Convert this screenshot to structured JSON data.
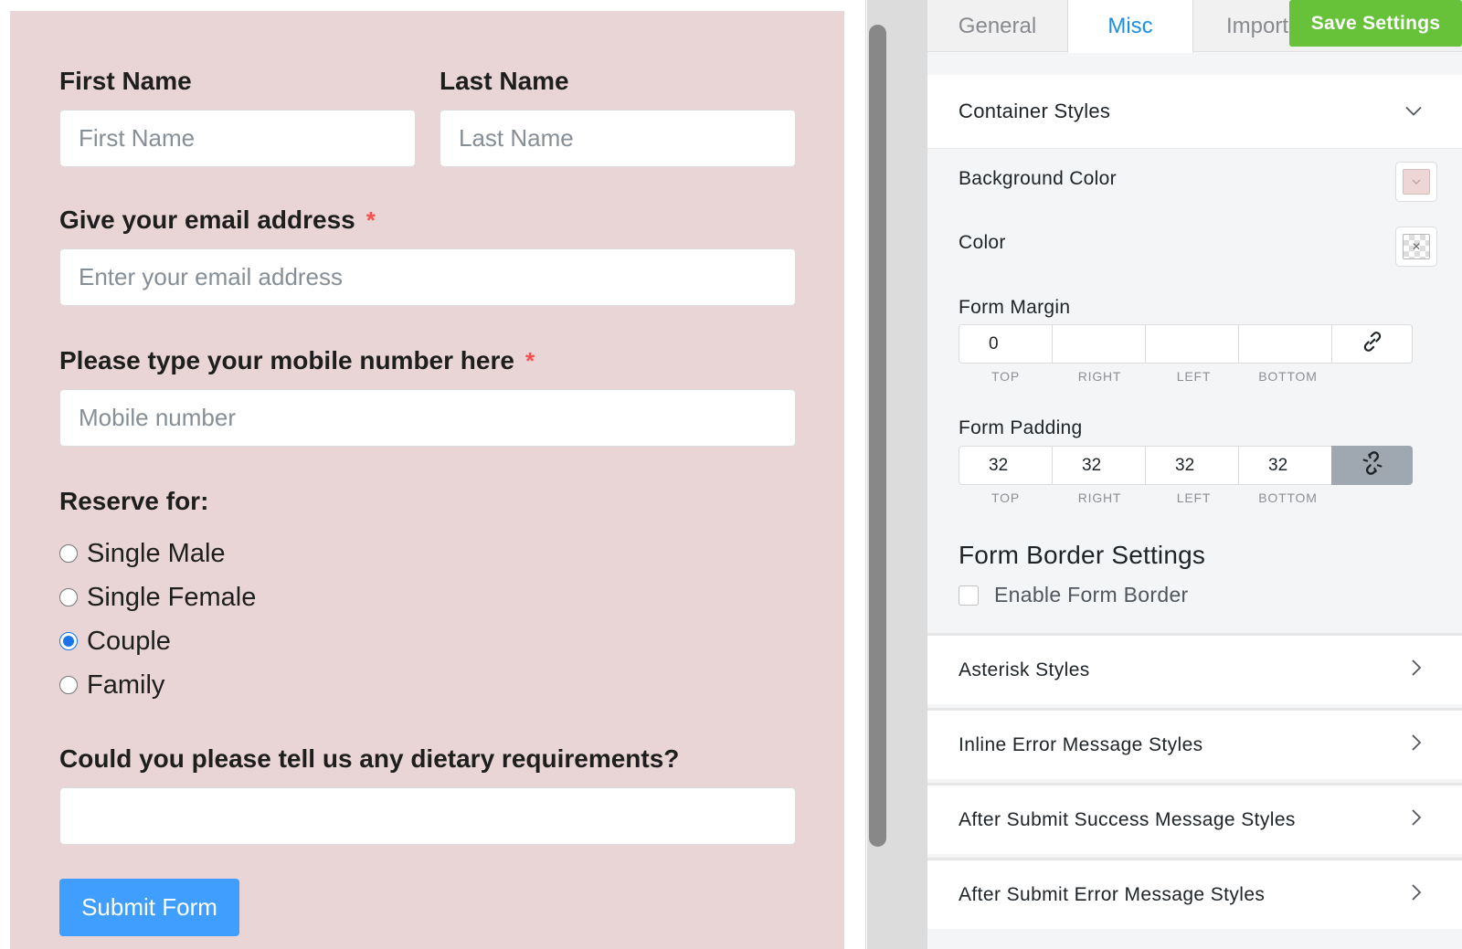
{
  "colors": {
    "form_bg": "#e9d5d5",
    "accent": "#409eff",
    "save": "#67c23a",
    "active_tab": "#1a8fe3",
    "required": "#ff4d4f"
  },
  "form": {
    "first_name": {
      "label": "First Name",
      "placeholder": "First Name",
      "value": ""
    },
    "last_name": {
      "label": "Last Name",
      "placeholder": "Last Name",
      "value": ""
    },
    "email": {
      "label": "Give your email address",
      "required_mark": "*",
      "placeholder": "Enter your email address",
      "value": ""
    },
    "mobile": {
      "label": "Please type your mobile number here",
      "required_mark": "*",
      "placeholder": "Mobile number",
      "value": ""
    },
    "reserve": {
      "label": "Reserve for:",
      "options": [
        {
          "label": "Single Male",
          "checked": false
        },
        {
          "label": "Single Female",
          "checked": false
        },
        {
          "label": "Couple",
          "checked": true
        },
        {
          "label": "Family",
          "checked": false
        }
      ]
    },
    "dietary": {
      "label": "Could you please tell us any dietary requirements?",
      "value": ""
    },
    "submit_label": "Submit Form"
  },
  "tabs": [
    {
      "label": "General",
      "active": false
    },
    {
      "label": "Misc",
      "active": true
    },
    {
      "label": "Import",
      "active": false
    }
  ],
  "save_label": "Save Settings",
  "settings": {
    "container_styles": {
      "title": "Container Styles",
      "expanded": true,
      "icon": "chevron-down-icon"
    },
    "background_color": {
      "label": "Background Color",
      "value": "#eed6d6"
    },
    "color": {
      "label": "Color",
      "value": ""
    },
    "form_margin": {
      "label": "Form Margin",
      "values": [
        "0",
        "",
        "",
        ""
      ],
      "captions": [
        "TOP",
        "RIGHT",
        "LEFT",
        "BOTTOM"
      ],
      "linked": false,
      "icon": "link-icon"
    },
    "form_padding": {
      "label": "Form Padding",
      "values": [
        "32",
        "32",
        "32",
        "32"
      ],
      "captions": [
        "TOP",
        "RIGHT",
        "LEFT",
        "BOTTOM"
      ],
      "linked": true,
      "icon": "unlink-icon"
    },
    "border": {
      "heading": "Form Border Settings",
      "enable_label": "Enable Form Border",
      "enabled": false
    }
  },
  "accordions": [
    {
      "title": "Asterisk Styles"
    },
    {
      "title": "Inline Error Message Styles"
    },
    {
      "title": "After Submit Success Message Styles"
    },
    {
      "title": "After Submit Error Message Styles"
    }
  ]
}
